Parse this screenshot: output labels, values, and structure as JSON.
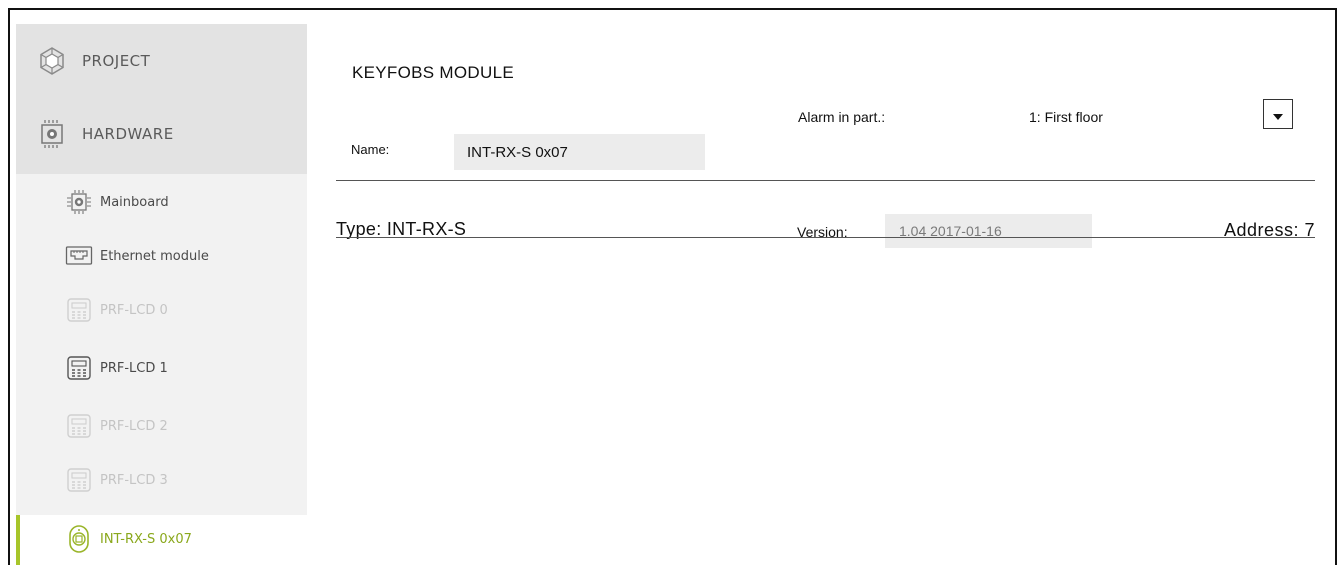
{
  "sidebar": {
    "project_label": "PROJECT",
    "hardware_label": "HARDWARE",
    "items": [
      {
        "label": "Mainboard",
        "icon": "mainboard-icon",
        "state": "normal"
      },
      {
        "label": "Ethernet module",
        "icon": "ethernet-icon",
        "state": "normal"
      },
      {
        "label": "PRF-LCD 0",
        "icon": "keypad-icon",
        "state": "disabled"
      },
      {
        "label": "PRF-LCD 1",
        "icon": "keypad-icon",
        "state": "normal"
      },
      {
        "label": "PRF-LCD 2",
        "icon": "keypad-icon",
        "state": "disabled"
      },
      {
        "label": "PRF-LCD 3",
        "icon": "keypad-icon",
        "state": "disabled"
      },
      {
        "label": "INT-RX-S 0x07",
        "icon": "keyfob-icon",
        "state": "active"
      }
    ]
  },
  "module": {
    "title": "KEYFOBS MODULE",
    "name_label": "Name:",
    "name_value": "INT-RX-S 0x07",
    "alarm_label": "Alarm in part.:",
    "alarm_value": "1: First floor",
    "type_label": "Type:  INT-RX-S",
    "version_label": "Version:",
    "version_value": "1.04 2017-01-16",
    "address_label": "Address: 7"
  },
  "colors": {
    "accent": "#a7c52a",
    "disabled_text": "#c4c4c4"
  }
}
